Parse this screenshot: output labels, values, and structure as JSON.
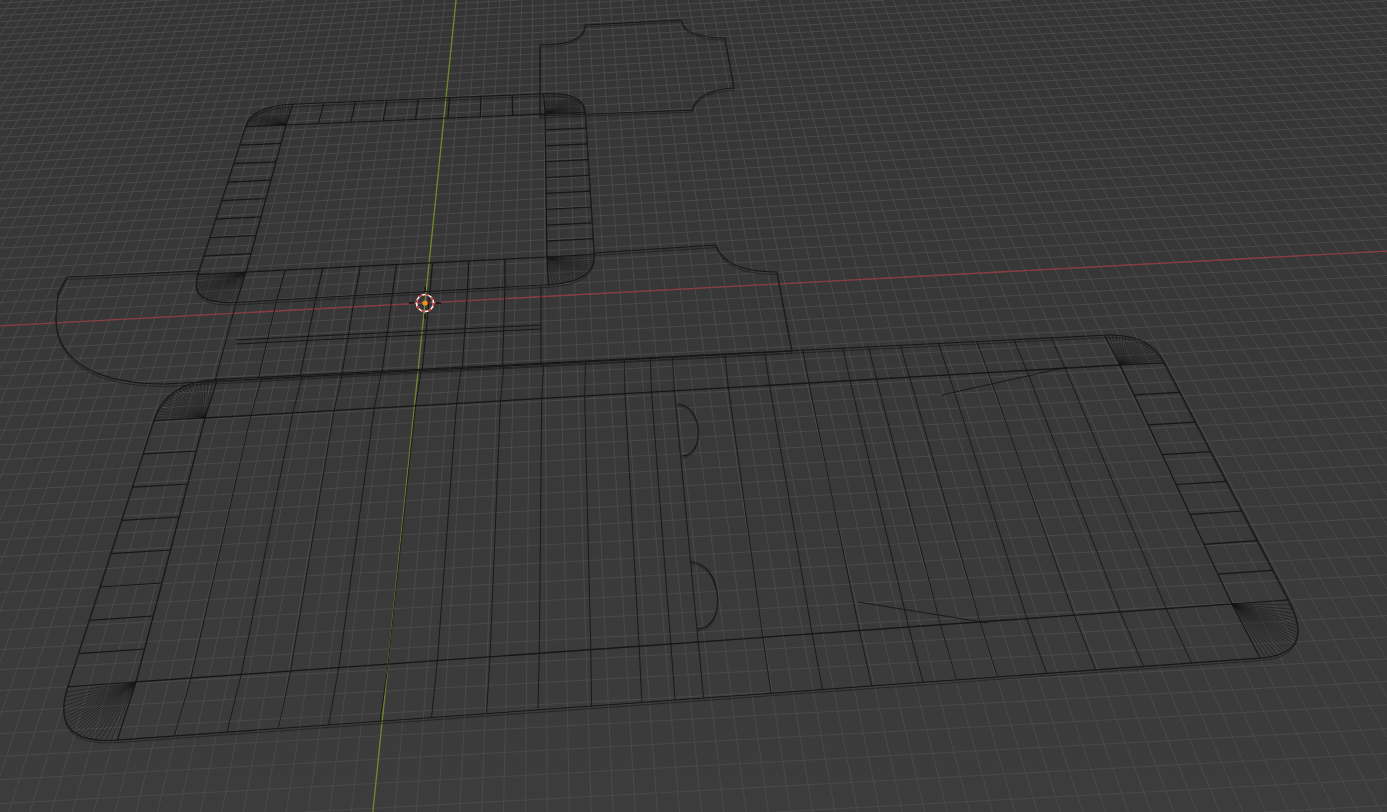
{
  "viewport": {
    "axes": [
      {
        "kind": "x",
        "color": "#8b3c43"
      },
      {
        "kind": "y",
        "color": "#6b8a2b"
      }
    ]
  }
}
